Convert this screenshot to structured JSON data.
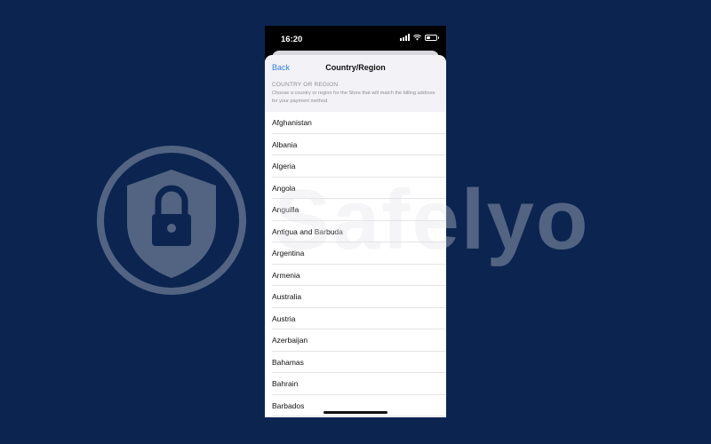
{
  "status_bar": {
    "time": "16:20"
  },
  "nav": {
    "back_label": "Back",
    "title": "Country/Region"
  },
  "section": {
    "title": "COUNTRY OR REGION",
    "description": "Choose a country or region for the Store that will match the billing address for your payment method."
  },
  "countries": [
    "Afghanistan",
    "Albania",
    "Algeria",
    "Angola",
    "Anguilla",
    "Antigua and Barbuda",
    "Argentina",
    "Armenia",
    "Australia",
    "Austria",
    "Azerbaijan",
    "Bahamas",
    "Bahrain",
    "Barbados"
  ],
  "watermark": {
    "text": "Safelyo"
  },
  "colors": {
    "background": "#0b2550",
    "accent": "#2f80ed",
    "sheet": "#f2f2f7"
  }
}
